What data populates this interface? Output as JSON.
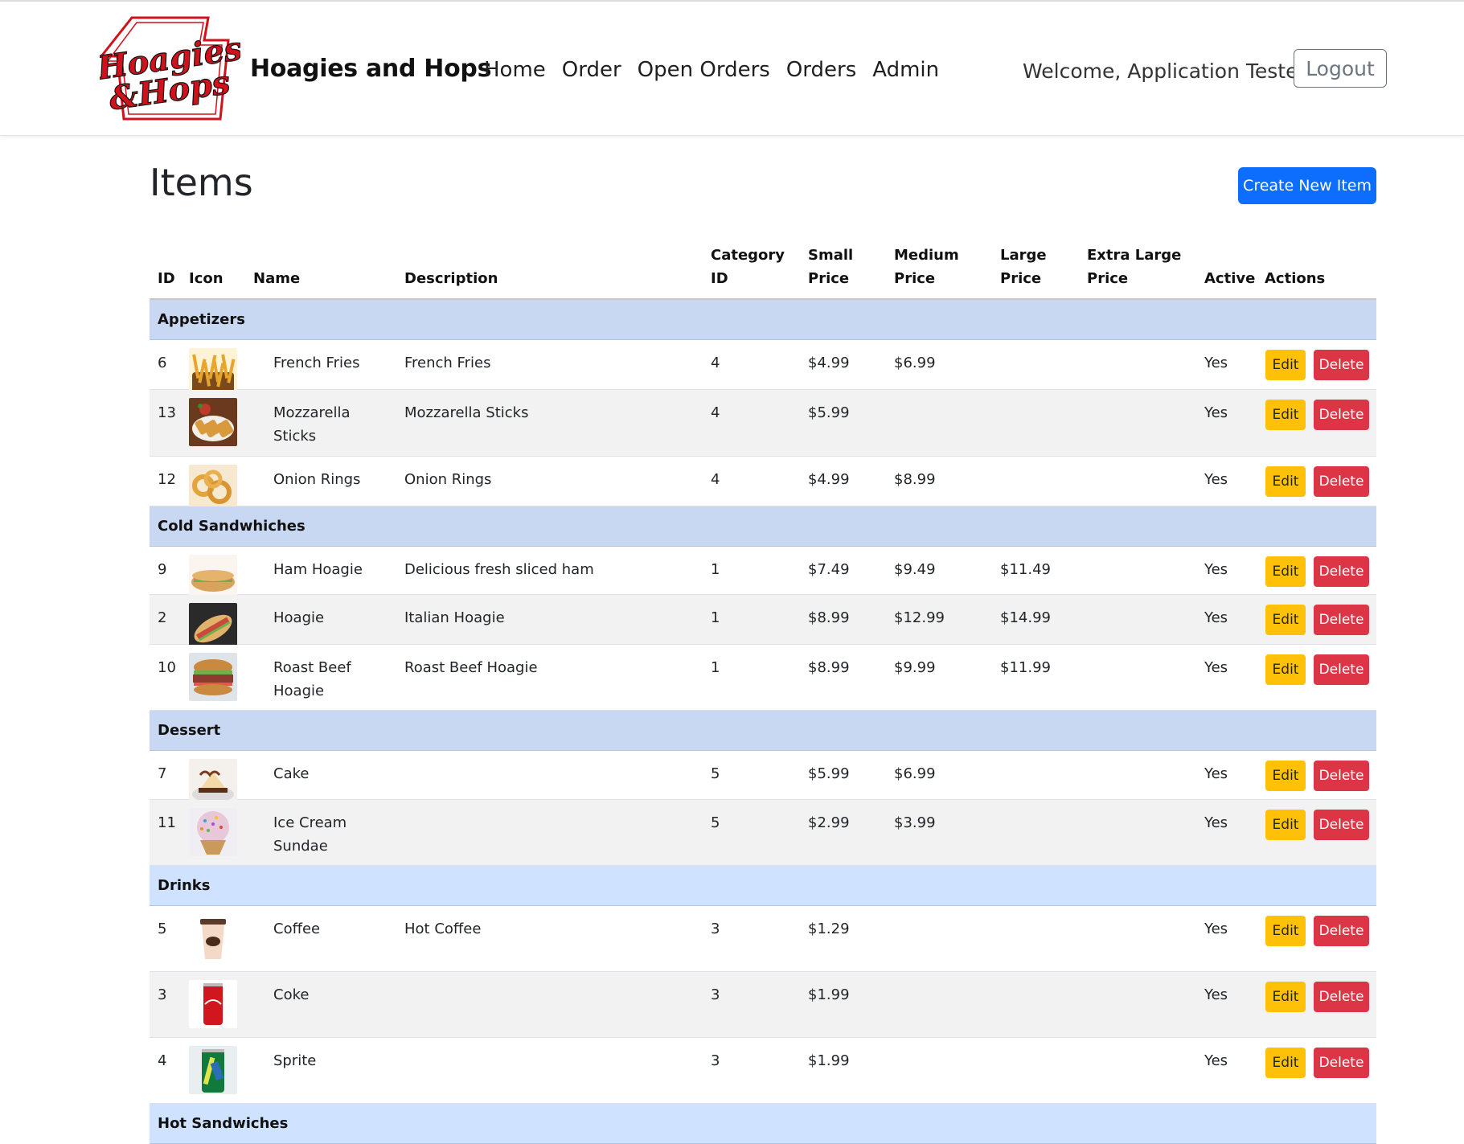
{
  "app": {
    "brand": "Hoagies and Hops",
    "logo_text_top": "Hoagies",
    "logo_text_bottom": "&Hops",
    "nav": [
      "Home",
      "Order",
      "Open Orders",
      "Orders",
      "Admin"
    ],
    "welcome": "Welcome, Application Tester",
    "logout_label": "Logout",
    "colors": {
      "primary": "#0d6efd",
      "warning": "#ffc107",
      "danger": "#dc3545",
      "group_bg": "#c8d8f3",
      "logo_red": "#d1111c"
    }
  },
  "page": {
    "title": "Items",
    "create_label": "Create New Item"
  },
  "table": {
    "headers": {
      "id": "ID",
      "icon": "Icon",
      "name": "Name",
      "description": "Description",
      "category_1": "Category",
      "category_2": "ID",
      "small_1": "Small",
      "small_2": "Price",
      "medium_1": "Medium",
      "medium_2": "Price",
      "large_1": "Large",
      "large_2": "Price",
      "xl_1": "Extra Large",
      "xl_2": "Price",
      "active": "Active",
      "actions": "Actions"
    },
    "edit_label": "Edit",
    "delete_label": "Delete",
    "groups": [
      {
        "name": "Appetizers",
        "items": [
          {
            "id": "6",
            "icon": "fries-image",
            "name": "French Fries",
            "description": "French Fries",
            "category": "4",
            "small": "$4.99",
            "medium": "$6.99",
            "large": "",
            "xl": "",
            "active": "Yes"
          },
          {
            "id": "13",
            "icon": "mozzarella-sticks-image",
            "name": "Mozzarella Sticks",
            "description": "Mozzarella Sticks",
            "category": "4",
            "small": "$5.99",
            "medium": "",
            "large": "",
            "xl": "",
            "active": "Yes"
          },
          {
            "id": "12",
            "icon": "onion-rings-image",
            "name": "Onion Rings",
            "description": "Onion Rings",
            "category": "4",
            "small": "$4.99",
            "medium": "$8.99",
            "large": "",
            "xl": "",
            "active": "Yes"
          }
        ]
      },
      {
        "name": "Cold Sandwhiches",
        "items": [
          {
            "id": "9",
            "icon": "ham-hoagie-image",
            "name": "Ham Hoagie",
            "description": "Delicious fresh sliced ham",
            "category": "1",
            "small": "$7.49",
            "medium": "$9.49",
            "large": "$11.49",
            "xl": "",
            "active": "Yes"
          },
          {
            "id": "2",
            "icon": "hoagie-image",
            "name": "Hoagie",
            "description": "Italian Hoagie",
            "category": "1",
            "small": "$8.99",
            "medium": "$12.99",
            "large": "$14.99",
            "xl": "",
            "active": "Yes"
          },
          {
            "id": "10",
            "icon": "roast-beef-image",
            "name": "Roast Beef Hoagie",
            "description": "Roast Beef Hoagie",
            "category": "1",
            "small": "$8.99",
            "medium": "$9.99",
            "large": "$11.99",
            "xl": "",
            "active": "Yes"
          }
        ]
      },
      {
        "name": "Dessert",
        "items": [
          {
            "id": "7",
            "icon": "cake-image",
            "name": "Cake",
            "description": "",
            "category": "5",
            "small": "$5.99",
            "medium": "$6.99",
            "large": "",
            "xl": "",
            "active": "Yes"
          },
          {
            "id": "11",
            "icon": "ice-cream-sundae-image",
            "name": "Ice Cream Sundae",
            "description": "",
            "category": "5",
            "small": "$2.99",
            "medium": "$3.99",
            "large": "",
            "xl": "",
            "active": "Yes"
          }
        ]
      },
      {
        "name": "Drinks",
        "items": [
          {
            "id": "5",
            "icon": "coffee-cup-image",
            "name": "Coffee",
            "description": "Hot Coffee",
            "category": "3",
            "small": "$1.29",
            "medium": "",
            "large": "",
            "xl": "",
            "active": "Yes"
          },
          {
            "id": "3",
            "icon": "coke-can-image",
            "name": "Coke",
            "description": "",
            "category": "3",
            "small": "$1.99",
            "medium": "",
            "large": "",
            "xl": "",
            "active": "Yes"
          },
          {
            "id": "4",
            "icon": "sprite-can-image",
            "name": "Sprite",
            "description": "",
            "category": "3",
            "small": "$1.99",
            "medium": "",
            "large": "",
            "xl": "",
            "active": "Yes"
          }
        ]
      },
      {
        "name": "Hot Sandwiches",
        "items": []
      }
    ]
  }
}
